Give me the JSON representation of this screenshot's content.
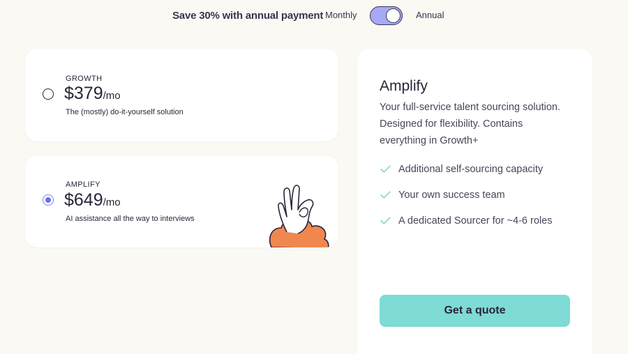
{
  "billing": {
    "save_text": "Save 30% with annual payment",
    "monthly_label": "Monthly",
    "annual_label": "Annual",
    "annual_selected": true
  },
  "plans": [
    {
      "name": "GROWTH",
      "price": "$379",
      "period": "/mo",
      "tagline": "The (mostly) do-it-yourself solution",
      "selected": false
    },
    {
      "name": "AMPLIFY",
      "price": "$649",
      "period": "/mo",
      "tagline": "AI assistance all the way to interviews",
      "selected": true
    }
  ],
  "detail": {
    "title": "Amplify",
    "description": "Your full-service talent sourcing solution. Designed for flexibility. Contains everything in Growth+",
    "features": [
      "Additional self-sourcing capacity",
      "Your own success team",
      "A dedicated Sourcer for ~4-6 roles"
    ],
    "cta_label": "Get a quote"
  },
  "colors": {
    "background": "#fbf9f3",
    "accent_purple": "#a7a9f5",
    "cta_teal": "#7edbd5",
    "check_teal": "#8fdcd6",
    "illustration_orange": "#f0874f"
  },
  "icons": {
    "feature_icon": "check-icon",
    "illustration": "ok-hand-illustration"
  }
}
